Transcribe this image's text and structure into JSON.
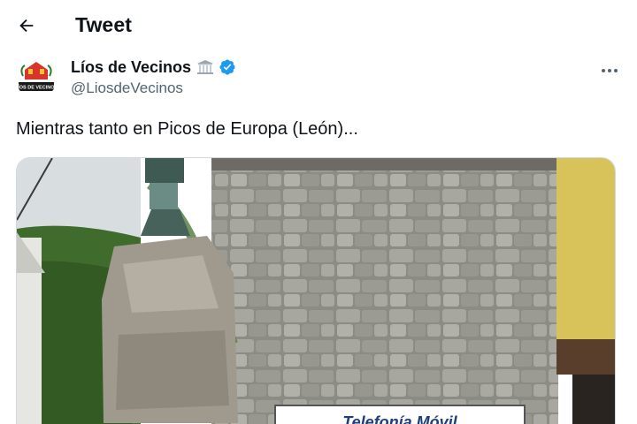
{
  "header": {
    "title": "Tweet",
    "back_icon": "arrow-left-icon"
  },
  "author": {
    "display_name": "Líos de Vecinos",
    "handle": "@LiosdeVecinos",
    "building_icon": "classical-building-icon",
    "verified_icon": "verified-badge-icon",
    "avatar_text": "LÍOS DE VECINOS",
    "more_icon": "more-options-icon"
  },
  "tweet": {
    "text": "Mientras tanto en Picos de Europa (León)..."
  },
  "media": {
    "sign_text": "Telefonía Móvil"
  },
  "colors": {
    "text": "#0f1419",
    "secondary": "#536471",
    "verified": "#1d9bf0",
    "border": "#cfd9de"
  }
}
